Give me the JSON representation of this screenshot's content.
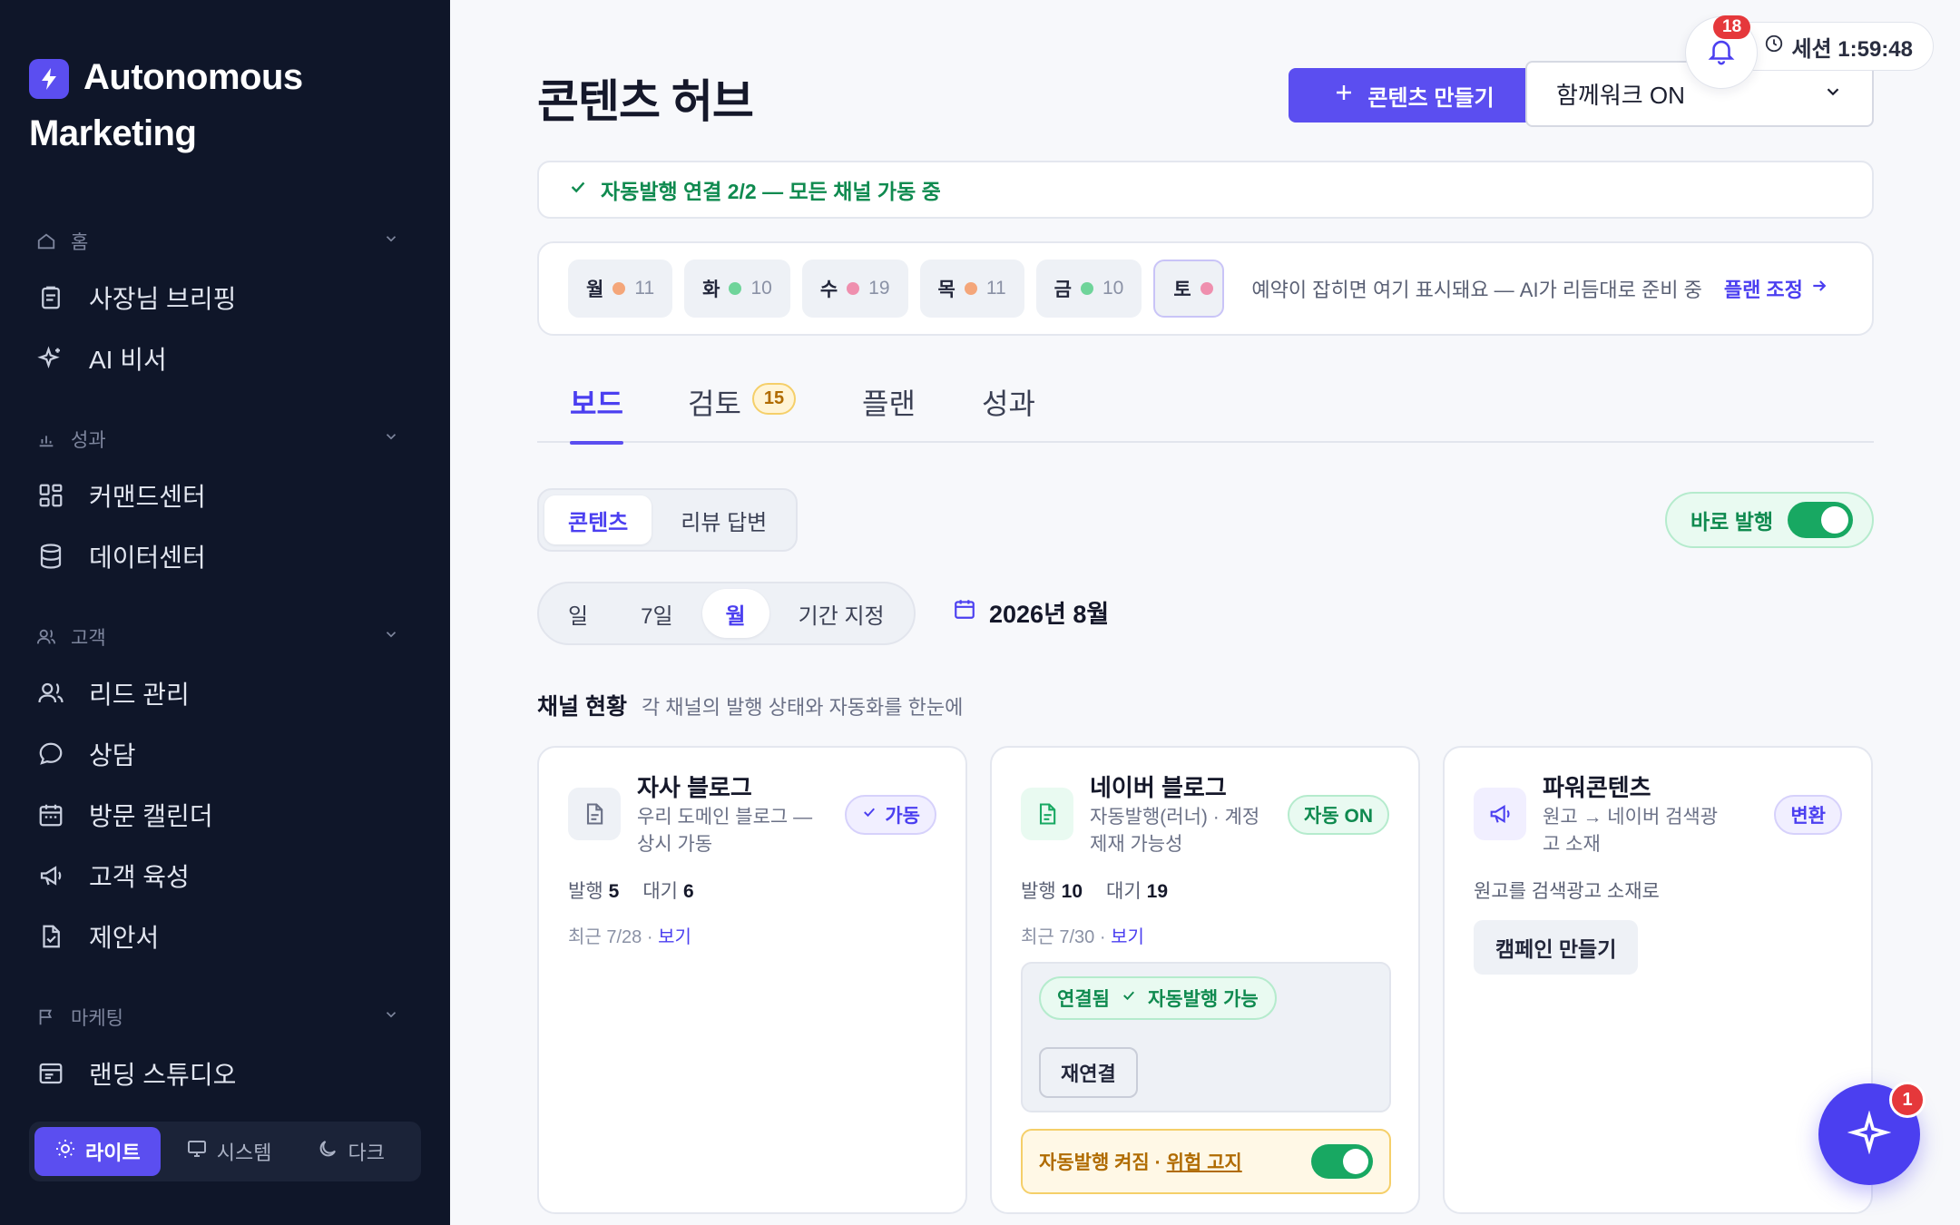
{
  "brand": {
    "line1": "Autonomous",
    "line2": "Marketing"
  },
  "sidebar": {
    "sections": [
      {
        "label": "홈",
        "items": [
          {
            "label": "사장님 브리핑"
          },
          {
            "label": "AI 비서"
          }
        ]
      },
      {
        "label": "성과",
        "items": [
          {
            "label": "커맨드센터"
          },
          {
            "label": "데이터센터"
          }
        ]
      },
      {
        "label": "고객",
        "items": [
          {
            "label": "리드 관리"
          },
          {
            "label": "상담"
          },
          {
            "label": "방문 캘린더"
          },
          {
            "label": "고객 육성"
          },
          {
            "label": "제안서"
          }
        ]
      },
      {
        "label": "마케팅",
        "items": [
          {
            "label": "랜딩 스튜디오"
          }
        ]
      }
    ],
    "theme": {
      "light": "라이트",
      "system": "시스템",
      "dark": "다크"
    }
  },
  "header": {
    "title": "콘텐츠 허브",
    "create_label": "콘텐츠 만들기",
    "together_value": "함께워크 ON",
    "notifications_count": "18",
    "session_label": "세션 1:59:48"
  },
  "status_banner": "자동발행 연결 2/2 — 모든 채널 가동 중",
  "week": {
    "days": [
      {
        "label": "월",
        "count": "11",
        "color": "#f4a67a"
      },
      {
        "label": "화",
        "count": "10",
        "color": "#6fd49a"
      },
      {
        "label": "수",
        "count": "19",
        "color": "#ef8fae"
      },
      {
        "label": "목",
        "count": "11",
        "color": "#f4a67a"
      },
      {
        "label": "금",
        "count": "10",
        "color": "#6fd49a"
      },
      {
        "label": "토",
        "count": "",
        "color": "#ef8fae"
      }
    ],
    "message": "예약이 잡히면 여기 표시돼요 — AI가 리듬대로 준비 중",
    "plan_adjust": "플랜 조정"
  },
  "tabs": [
    {
      "label": "보드",
      "active": true
    },
    {
      "label": "검토",
      "badge": "15"
    },
    {
      "label": "플랜"
    },
    {
      "label": "성과"
    }
  ],
  "content_toggle": {
    "content": "콘텐츠",
    "review": "리뷰 답변"
  },
  "instant_publish": "바로 발행",
  "period": {
    "day": "일",
    "week": "7일",
    "month": "월",
    "custom": "기간 지정",
    "current": "2026년 8월"
  },
  "channels": {
    "title": "채널 현황",
    "subtitle": "각 채널의 발행 상태와 자동화를 한눈에",
    "cards": [
      {
        "name": "자사 블로그",
        "desc": "우리 도메인 블로그 — 상시 가동",
        "badge": "가동",
        "published_label": "발행",
        "published": "5",
        "waiting_label": "대기",
        "waiting": "6",
        "recent": "최근 7/28 · ",
        "view": "보기"
      },
      {
        "name": "네이버 블로그",
        "desc": "자동발행(러너) · 계정 제재 가능성",
        "badge": "자동 ON",
        "published_label": "발행",
        "published": "10",
        "waiting_label": "대기",
        "waiting": "19",
        "recent": "최근 7/30 · ",
        "view": "보기",
        "conn_connected": "연결됨",
        "conn_auto": "자동발행 가능",
        "reconnect": "재연결",
        "warn_text": "자동발행 켜짐 · ",
        "warn_link": "위험 고지"
      },
      {
        "name": "파워콘텐츠",
        "desc": "원고 → 네이버 검색광고 소재",
        "badge": "변환",
        "plain": "원고를 검색광고 소재로",
        "campaign": "캠페인 만들기"
      }
    ]
  },
  "fab_badge": "1",
  "colors": {
    "accent": "#5b4ef0",
    "success": "#0f8a4f",
    "warning": "#b06b00",
    "danger": "#e5383b",
    "sidebar_bg": "#0f1629"
  }
}
